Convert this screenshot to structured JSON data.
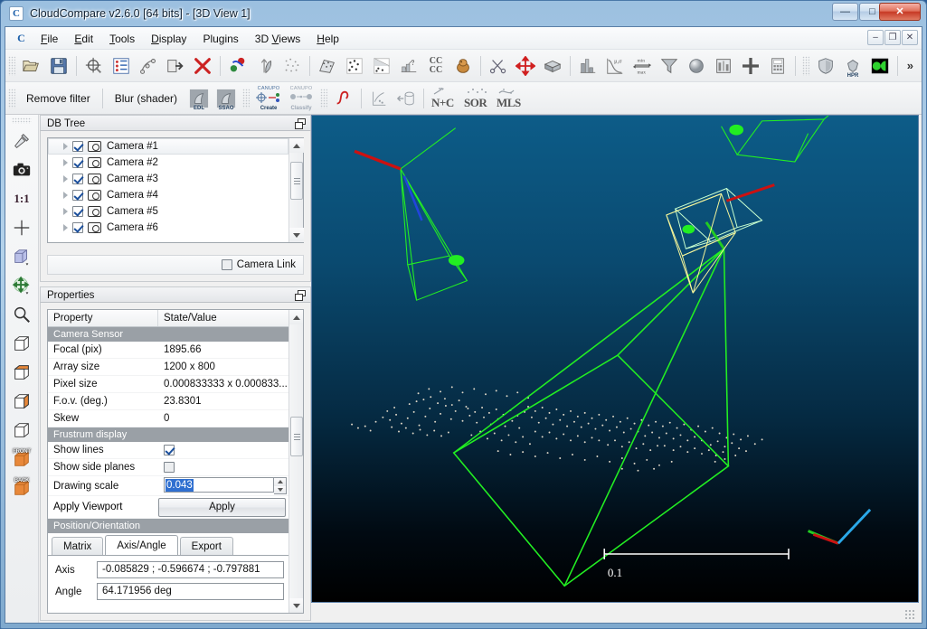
{
  "window": {
    "title": "CloudCompare v2.6.0 [64 bits] - [3D View 1]",
    "app_icon": "C",
    "minimize_glyph": "—",
    "maximize_glyph": "□",
    "close_glyph": "✕",
    "mdi_minimize_glyph": "–",
    "mdi_restore_glyph": "❐",
    "mdi_close_glyph": "✕"
  },
  "menu": {
    "logo": "C",
    "items": [
      {
        "label": "File",
        "mnemonic": "F"
      },
      {
        "label": "Edit",
        "mnemonic": "E"
      },
      {
        "label": "Tools",
        "mnemonic": "T"
      },
      {
        "label": "Display",
        "mnemonic": "D"
      },
      {
        "label": "Plugins",
        "mnemonic": "P"
      },
      {
        "label": "3D Views",
        "mnemonic": "V"
      },
      {
        "label": "Help",
        "mnemonic": "H"
      }
    ]
  },
  "toolbar_main": {
    "overflow_label": "»",
    "buttons": [
      {
        "name": "open-icon",
        "tip": "Open"
      },
      {
        "name": "save-icon",
        "tip": "Save"
      },
      {
        "name": "global-shift-icon",
        "tip": "Global shift settings"
      },
      {
        "name": "db-tree-icon",
        "tip": "Toggle DB tree"
      },
      {
        "name": "clone-icon",
        "tip": "Clone"
      },
      {
        "name": "merge-icon",
        "tip": "Merge"
      },
      {
        "name": "delete-icon",
        "tip": "Delete"
      },
      {
        "name": "point-picking-icon",
        "tip": "Point picking"
      },
      {
        "name": "segment-icon",
        "tip": "Segment"
      },
      {
        "name": "subsample-icon",
        "tip": "Subsample"
      },
      {
        "name": "mesh-icon",
        "tip": "Mesh"
      },
      {
        "name": "cloud-points-icon",
        "tip": "Cloud points"
      },
      {
        "name": "normals-icon",
        "tip": "Compute normals"
      },
      {
        "name": "histogram-icon",
        "tip": "Histogram"
      },
      {
        "name": "cc-compare-icon",
        "tip": "Cloud/cloud distance"
      },
      {
        "name": "registration-icon",
        "tip": "Fine registration"
      },
      {
        "name": "scissors-icon",
        "tip": "Cut"
      },
      {
        "name": "translate-rotate-icon",
        "tip": "Translate/rotate"
      },
      {
        "name": "box-primitive-icon",
        "tip": "Primitive factory"
      },
      {
        "name": "stat-histogram-icon",
        "tip": "Compute statistics"
      },
      {
        "name": "gaussian-icon",
        "tip": "Statistical test"
      },
      {
        "name": "minmax-icon",
        "tip": "Min/max"
      },
      {
        "name": "filter-icon",
        "tip": "Filter by value"
      },
      {
        "name": "sphere-icon",
        "tip": "Fit sphere"
      },
      {
        "name": "scalar-field-icon",
        "tip": "Scalar fields"
      },
      {
        "name": "add-icon",
        "tip": "Add"
      },
      {
        "name": "calculator-icon",
        "tip": "Scalar field arithmetic"
      },
      {
        "name": "shield-icon",
        "tip": "qBroom"
      },
      {
        "name": "hpr-icon",
        "tip": "HPR"
      },
      {
        "name": "kinect-icon",
        "tip": "Kinect"
      }
    ],
    "icon_texts": {
      "cc": "CC\nCC",
      "minmax_top": "min",
      "minmax_bottom": "max",
      "hpr": "HPR"
    }
  },
  "toolbar_filters": {
    "remove_filter": "Remove filter",
    "blur_shader": "Blur (shader)",
    "edl_label": "EDL",
    "ssao_label": "SSAO",
    "canupo_create_top": "CANUPO",
    "canupo_create_bottom": "Create",
    "canupo_classify_top": "CANUPO",
    "canupo_classify_bottom": "Classify",
    "nc_label": "N+C",
    "sor_label": "SOR",
    "mls_label": "MLS",
    "buttons": [
      {
        "name": "curvature-icon",
        "tip": "Curvature"
      },
      {
        "name": "scatter-tool-icon",
        "tip": "Scatter tool"
      },
      {
        "name": "unroll-icon",
        "tip": "Unroll"
      }
    ]
  },
  "left_toolbar": {
    "buttons": [
      {
        "name": "pick-rotation-center-icon",
        "label": ""
      },
      {
        "name": "camera-snapshot-icon",
        "label": ""
      },
      {
        "name": "zoom-one-to-one-icon",
        "label": "1:1"
      },
      {
        "name": "crosshair-icon",
        "label": ""
      },
      {
        "name": "ortho-projection-icon",
        "label": ""
      },
      {
        "name": "pivot-move-icon",
        "label": ""
      },
      {
        "name": "zoom-icon",
        "label": ""
      },
      {
        "name": "view-top-icon",
        "label": ""
      },
      {
        "name": "view-bottom-icon",
        "label": ""
      },
      {
        "name": "view-left-icon",
        "label": ""
      },
      {
        "name": "view-right-icon",
        "label": ""
      },
      {
        "name": "view-iso1-icon",
        "label": ""
      },
      {
        "name": "view-iso2-icon",
        "label": ""
      },
      {
        "name": "view-front-icon",
        "label": "FRONT"
      },
      {
        "name": "view-back-icon",
        "label": "BACK"
      }
    ]
  },
  "db_tree": {
    "title": "DB Tree",
    "items": [
      {
        "label": "Camera #1",
        "checked": true,
        "selected": true
      },
      {
        "label": "Camera #2",
        "checked": true,
        "selected": false
      },
      {
        "label": "Camera #3",
        "checked": true,
        "selected": false
      },
      {
        "label": "Camera #4",
        "checked": true,
        "selected": false
      },
      {
        "label": "Camera #5",
        "checked": true,
        "selected": false
      },
      {
        "label": "Camera #6",
        "checked": true,
        "selected": false
      }
    ],
    "camera_link_label": "Camera Link",
    "camera_link_checked": false
  },
  "properties": {
    "title": "Properties",
    "header": {
      "property": "Property",
      "value": "State/Value"
    },
    "sections": [
      {
        "name": "Camera Sensor",
        "rows": [
          {
            "label": "Focal (pix)",
            "value": "1895.66",
            "type": "text"
          },
          {
            "label": "Array size",
            "value": "1200 x 800",
            "type": "text"
          },
          {
            "label": "Pixel size",
            "value": "0.000833333 x 0.000833...",
            "type": "text"
          },
          {
            "label": "F.o.v. (deg.)",
            "value": "23.8301",
            "type": "text"
          },
          {
            "label": "Skew",
            "value": "0",
            "type": "text"
          }
        ]
      },
      {
        "name": "Frustrum display",
        "rows": [
          {
            "label": "Show lines",
            "value": "",
            "type": "checkbox",
            "checked": true
          },
          {
            "label": "Show side planes",
            "value": "",
            "type": "checkbox",
            "checked": false
          },
          {
            "label": "Drawing scale",
            "value": "0.043",
            "type": "spinbox",
            "selected": true
          },
          {
            "label": "Apply Viewport",
            "value": "Apply",
            "type": "button"
          }
        ]
      },
      {
        "name": "Position/Orientation",
        "rows": []
      }
    ],
    "tabs": [
      {
        "label": "Matrix",
        "active": false
      },
      {
        "label": "Axis/Angle",
        "active": true
      },
      {
        "label": "Export",
        "active": false
      }
    ],
    "fields": [
      {
        "label": "Axis",
        "value": "-0.085829 ; -0.596674 ; -0.797881"
      },
      {
        "label": "Angle",
        "value": "64.171956 deg"
      }
    ]
  },
  "view3d": {
    "scale_bar_label": "0.1",
    "colors": {
      "background_top": "#0d5c88",
      "background_bottom": "#000000",
      "frustum_green": "#22ee22",
      "frustum_yellow": "#ffff66",
      "axis_red": "#cc1111",
      "axis_green": "#22cc22",
      "axis_blue": "#2244dd",
      "point_cloud": "#d8d0c0"
    }
  }
}
